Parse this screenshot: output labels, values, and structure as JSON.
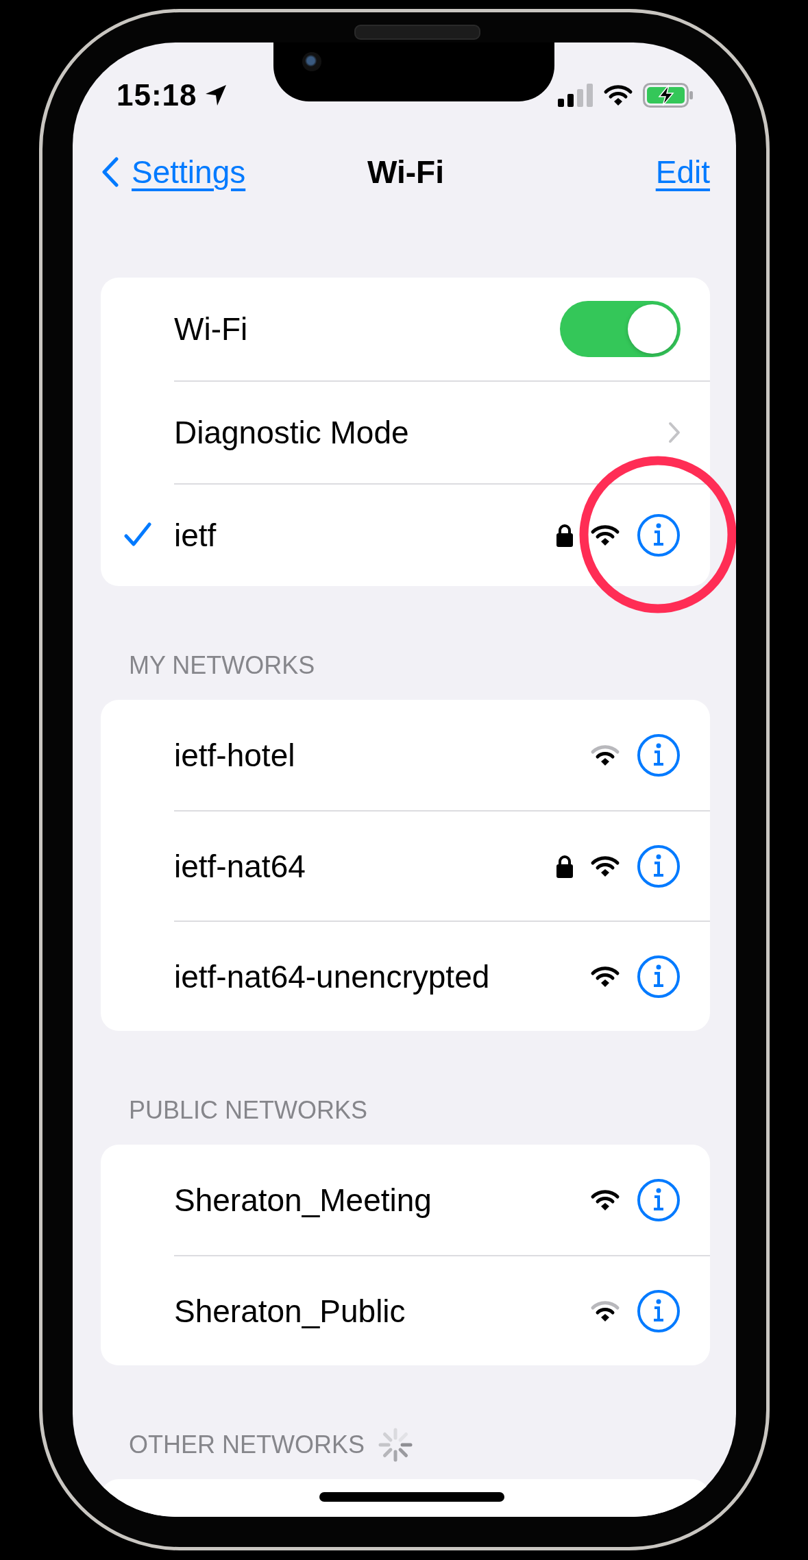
{
  "status_bar": {
    "time": "15:18"
  },
  "nav": {
    "back": "Settings",
    "title": "Wi-Fi",
    "action": "Edit"
  },
  "main_rows": [
    {
      "kind": "toggle",
      "label": "Wi-Fi",
      "on": true
    },
    {
      "kind": "link",
      "label": "Diagnostic Mode"
    },
    {
      "kind": "network",
      "label": "ietf",
      "selected": true,
      "locked": true,
      "full_signal": true,
      "highlighted": true
    }
  ],
  "sections": [
    {
      "header": "MY NETWORKS",
      "loading": false,
      "networks": [
        {
          "name": "ietf-hotel",
          "selected": false,
          "locked": false,
          "full_signal": false,
          "highlighted": false
        },
        {
          "name": "ietf-nat64",
          "selected": false,
          "locked": true,
          "full_signal": true,
          "highlighted": false
        },
        {
          "name": "ietf-nat64-unencrypted",
          "selected": false,
          "locked": false,
          "full_signal": true,
          "highlighted": false
        }
      ]
    },
    {
      "header": "PUBLIC NETWORKS",
      "loading": false,
      "networks": [
        {
          "name": "Sheraton_Meeting",
          "selected": false,
          "locked": false,
          "full_signal": true,
          "highlighted": false
        },
        {
          "name": "Sheraton_Public",
          "selected": false,
          "locked": false,
          "full_signal": false,
          "highlighted": false
        }
      ]
    },
    {
      "header": "OTHER NETWORKS",
      "loading": true
    }
  ]
}
